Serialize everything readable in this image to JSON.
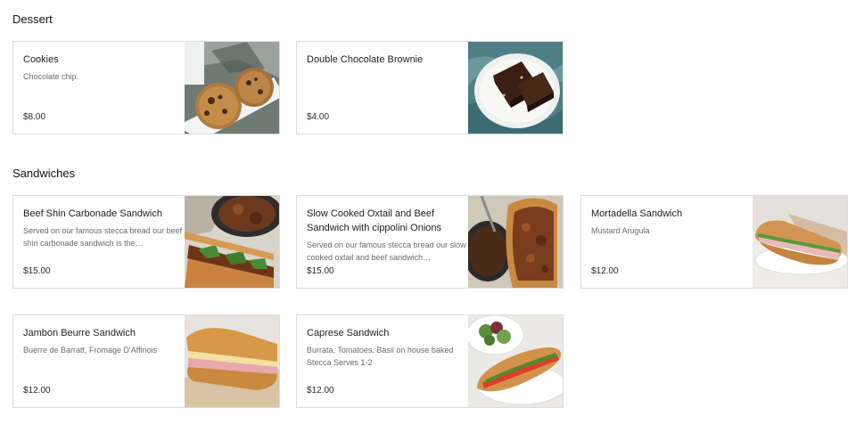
{
  "sections": [
    {
      "title": "Dessert",
      "items": [
        {
          "name": "Cookies",
          "description": "Chocolate chip.",
          "price": "$8.00"
        },
        {
          "name": "Double Chocolate Brownie",
          "description": "",
          "price": "$4.00"
        }
      ]
    },
    {
      "title": "Sandwiches",
      "items": [
        {
          "name": "Beef Shin Carbonade Sandwich",
          "description": "Served on our famous stecca bread our beef shin carbonade sandwich is the…",
          "price": "$15.00"
        },
        {
          "name": "Slow Cooked Oxtail and Beef Sandwich with cippolini Onions",
          "description": "Served on our famous stecca bread our slow cooked oxtail and beef sandwich…",
          "price": "$15.00"
        },
        {
          "name": "Mortadella Sandwich",
          "description": "Mustard Arugula",
          "price": "$12.00"
        },
        {
          "name": "Jambon Beurre Sandwich",
          "description": "Buerre de Barratt, Fromage D'Affinois",
          "price": "$12.00"
        },
        {
          "name": "Caprese Sandwich",
          "description": "Burrata, Tomatoes, Basil on house baked Stecca Serves 1-2",
          "price": "$12.00"
        }
      ]
    }
  ]
}
